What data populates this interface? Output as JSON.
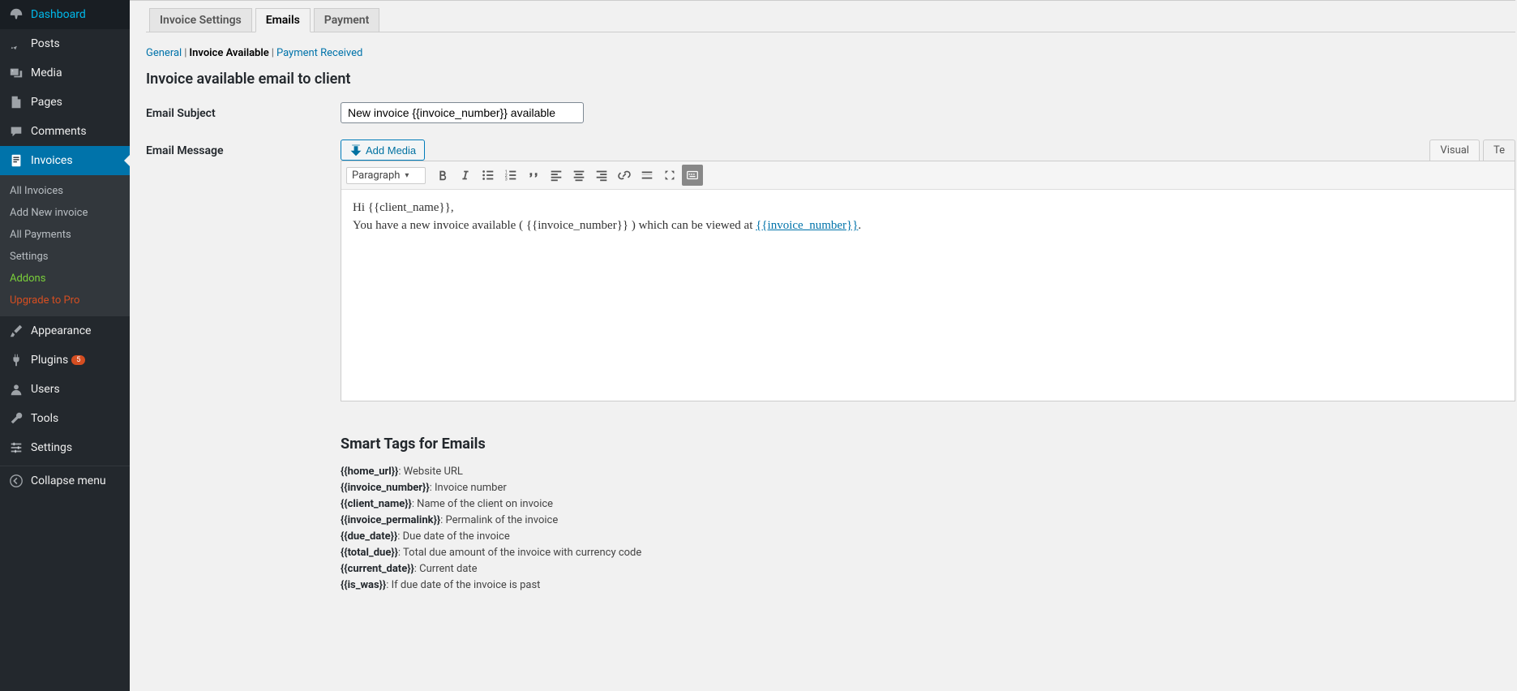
{
  "sidebar": {
    "items": [
      {
        "label": "Dashboard",
        "icon": "dashboard"
      },
      {
        "label": "Posts",
        "icon": "pin"
      },
      {
        "label": "Media",
        "icon": "media"
      },
      {
        "label": "Pages",
        "icon": "page"
      },
      {
        "label": "Comments",
        "icon": "comment"
      },
      {
        "label": "Invoices",
        "icon": "doc",
        "active": true
      },
      {
        "label": "Appearance",
        "icon": "brush"
      },
      {
        "label": "Plugins",
        "icon": "plug",
        "badge": "5"
      },
      {
        "label": "Users",
        "icon": "user"
      },
      {
        "label": "Tools",
        "icon": "wrench"
      },
      {
        "label": "Settings",
        "icon": "sliders"
      },
      {
        "label": "Collapse menu",
        "icon": "collapse"
      }
    ],
    "sub": [
      {
        "label": "All Invoices"
      },
      {
        "label": "Add New invoice"
      },
      {
        "label": "All Payments"
      },
      {
        "label": "Settings"
      },
      {
        "label": "Addons",
        "cls": "highlight-green"
      },
      {
        "label": "Upgrade to Pro",
        "cls": "highlight-orange"
      }
    ]
  },
  "tabs": [
    {
      "label": "Invoice Settings"
    },
    {
      "label": "Emails",
      "active": true
    },
    {
      "label": "Payment"
    }
  ],
  "subsub": [
    {
      "label": "General",
      "link": true
    },
    {
      "label": "Invoice Available",
      "current": true
    },
    {
      "label": "Payment Received",
      "link": true
    }
  ],
  "page_title": "Invoice available email to client",
  "labels": {
    "subject": "Email Subject",
    "message": "Email Message",
    "add_media": "Add Media",
    "paragraph": "Paragraph",
    "visual": "Visual",
    "text": "Te"
  },
  "fields": {
    "subject_value": "New invoice {{invoice_number}} available"
  },
  "editor": {
    "line1_pre": "Hi ",
    "line1_tok": "{{client_name}}",
    "line1_post": ",",
    "line2_pre": "You have a new invoice available ( ",
    "line2_tok": "{{invoice_number}}",
    "line2_mid": " ) which can be viewed at ",
    "line2_link": "{{invoice_number}}",
    "line2_end": "."
  },
  "smart_title": "Smart Tags for Emails",
  "smart_tags": [
    {
      "k": "{{home_url}}",
      "d": ": Website URL"
    },
    {
      "k": "{{invoice_number}}",
      "d": ": Invoice number"
    },
    {
      "k": "{{client_name}}",
      "d": ": Name of the client on invoice"
    },
    {
      "k": "{{invoice_permalink}}",
      "d": ": Permalink of the invoice"
    },
    {
      "k": "{{due_date}}",
      "d": ": Due date of the invoice"
    },
    {
      "k": "{{total_due}}",
      "d": ": Total due amount of the invoice with currency code"
    },
    {
      "k": "{{current_date}}",
      "d": ": Current date"
    },
    {
      "k": "{{is_was}}",
      "d": ": If due date of the invoice is past"
    }
  ]
}
